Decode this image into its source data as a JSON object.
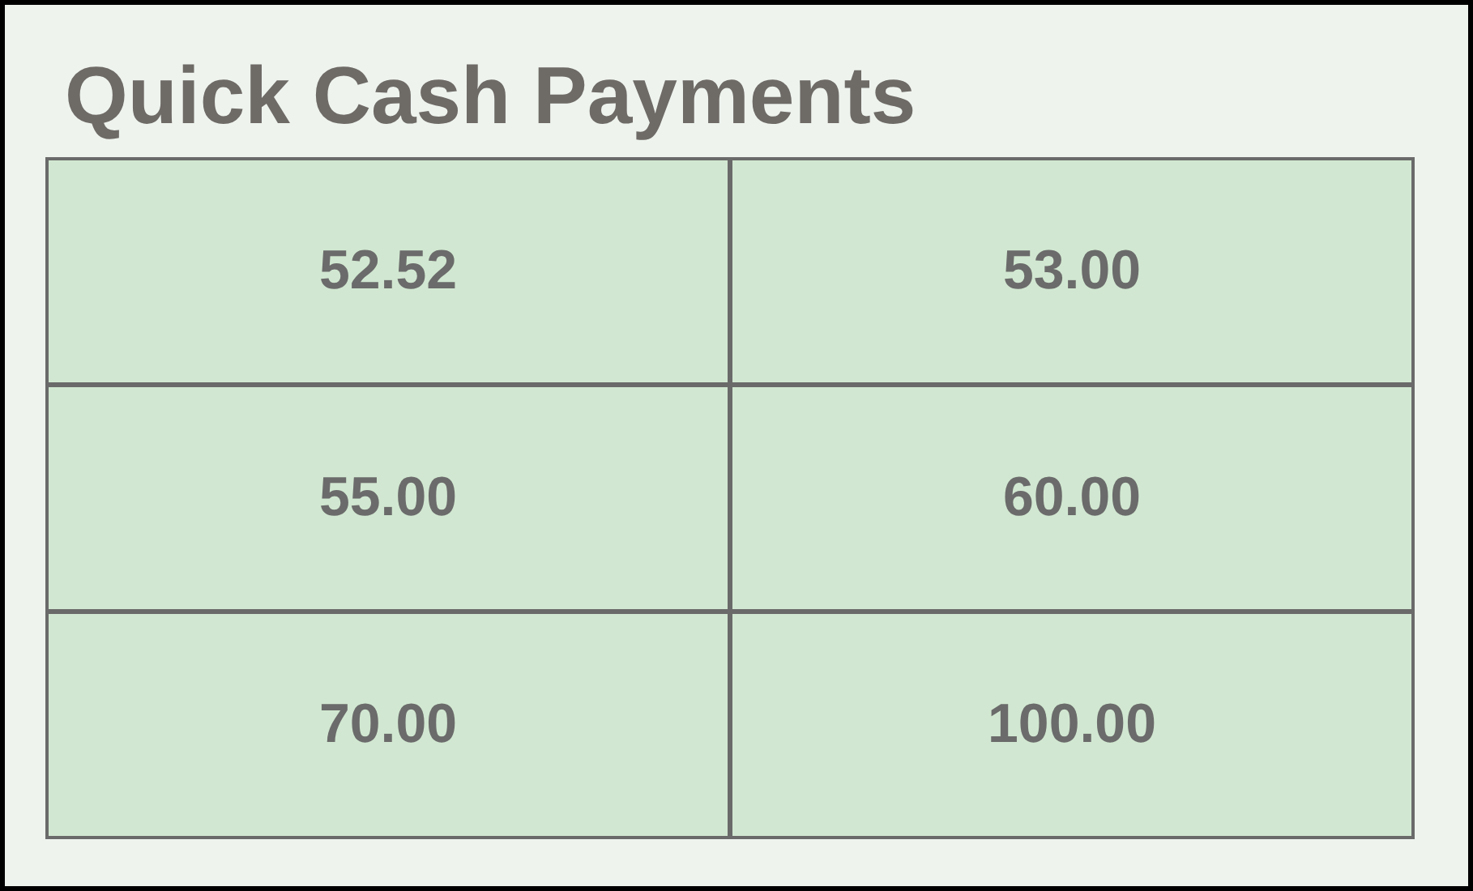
{
  "title": "Quick Cash Payments",
  "buttons": [
    {
      "label": "52.52"
    },
    {
      "label": "53.00"
    },
    {
      "label": "55.00"
    },
    {
      "label": "60.00"
    },
    {
      "label": "70.00"
    },
    {
      "label": "100.00"
    }
  ]
}
